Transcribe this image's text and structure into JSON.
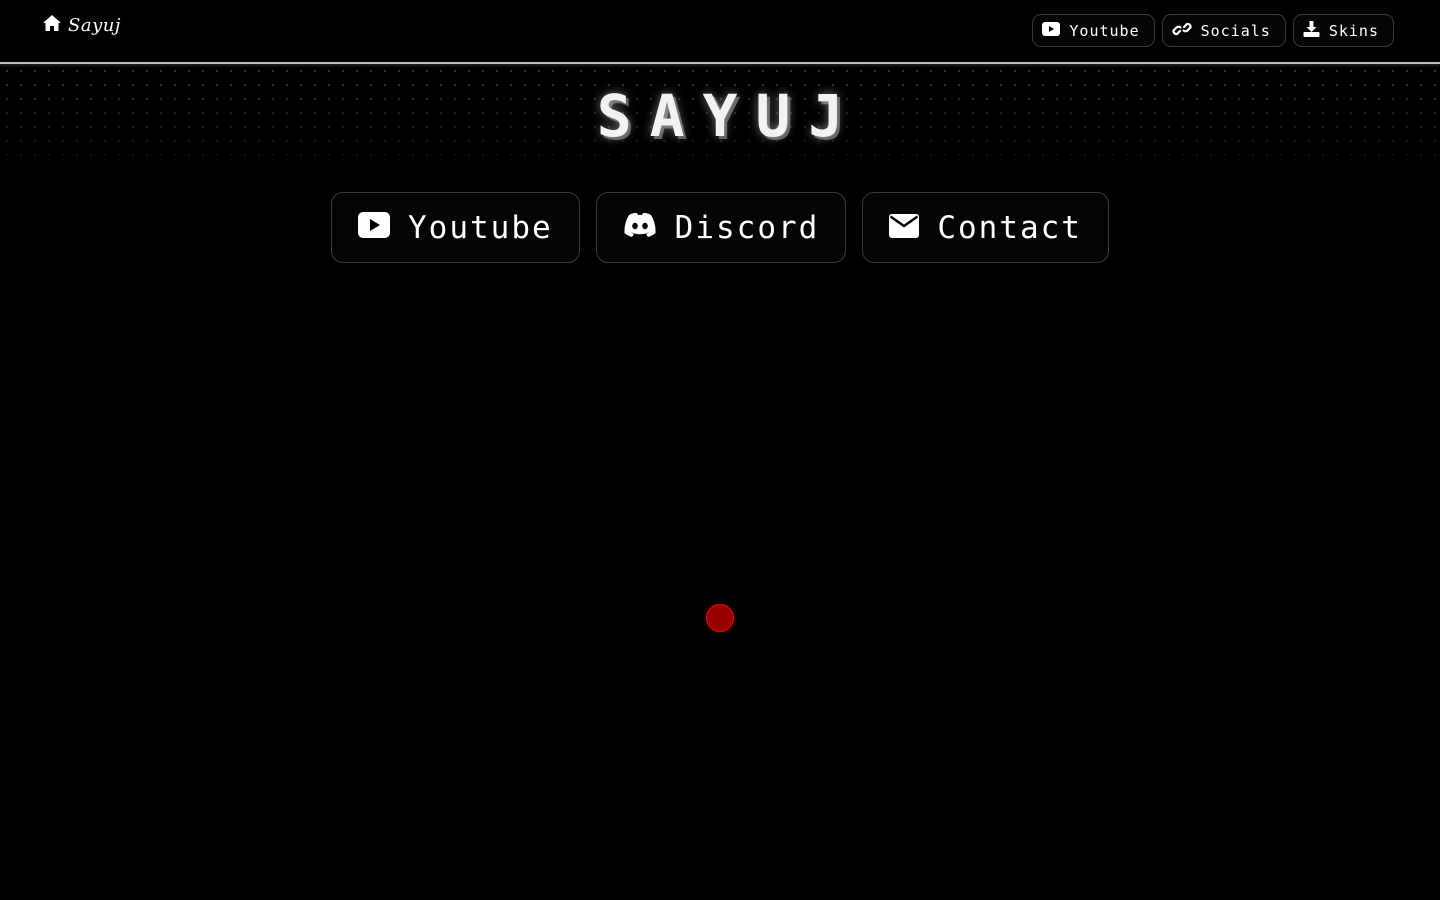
{
  "navbar": {
    "brand_label": "Sayuj",
    "brand_icon": "home-icon",
    "links": [
      {
        "label": "Youtube",
        "icon": "youtube-icon"
      },
      {
        "label": "Socials",
        "icon": "link-icon"
      },
      {
        "label": "Skins",
        "icon": "download-icon"
      }
    ]
  },
  "hero": {
    "title": "SAYUJ"
  },
  "main_links": [
    {
      "label": "Youtube",
      "icon": "youtube-icon"
    },
    {
      "label": "Discord",
      "icon": "discord-icon"
    },
    {
      "label": "Contact",
      "icon": "envelope-icon"
    }
  ],
  "colors": {
    "background": "#000000",
    "text": "#ffffff",
    "border": "#3a3a3a",
    "cursor": "#9a0000"
  }
}
